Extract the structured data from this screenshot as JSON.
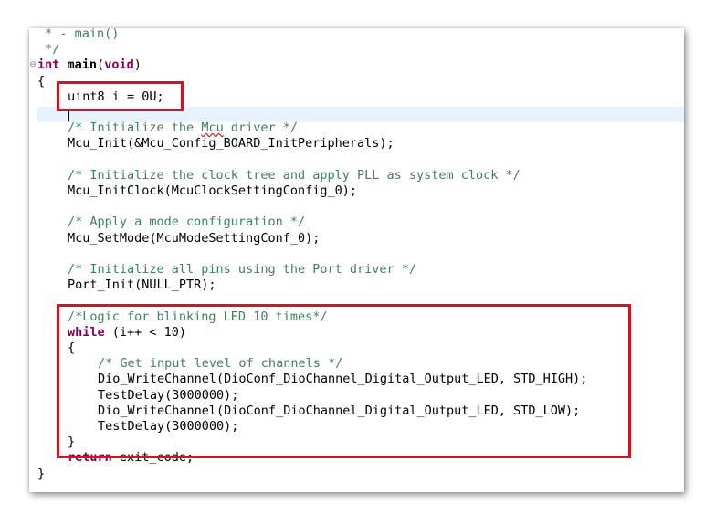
{
  "editor": {
    "lines": [
      {
        "indent": 0,
        "parts": [
          {
            "c": "cm",
            "t": " * - main()"
          }
        ]
      },
      {
        "indent": 0,
        "parts": [
          {
            "c": "cm",
            "t": " */"
          }
        ]
      },
      {
        "indent": 0,
        "fold": true,
        "parts": [
          {
            "c": "kw",
            "t": "int"
          },
          {
            "c": "",
            "t": " "
          },
          {
            "c": "b",
            "t": "main"
          },
          {
            "c": "",
            "t": "("
          },
          {
            "c": "kw",
            "t": "void"
          },
          {
            "c": "",
            "t": ")"
          }
        ]
      },
      {
        "indent": 0,
        "parts": [
          {
            "c": "",
            "t": "{"
          }
        ]
      },
      {
        "indent": 1,
        "parts": [
          {
            "c": "",
            "t": "uint8 i = 0U;"
          }
        ]
      },
      {
        "indent": 1,
        "parts": [
          {
            "c": "",
            "t": ""
          }
        ]
      },
      {
        "indent": 1,
        "parts": [
          {
            "c": "cm",
            "t": "/* Initialize the "
          },
          {
            "c": "cm ul",
            "t": "Mcu"
          },
          {
            "c": "cm",
            "t": " driver */"
          }
        ]
      },
      {
        "indent": 1,
        "parts": [
          {
            "c": "",
            "t": "Mcu_Init(&Mcu_Config_BOARD_InitPeripherals);"
          }
        ]
      },
      {
        "indent": 1,
        "parts": [
          {
            "c": "",
            "t": ""
          }
        ]
      },
      {
        "indent": 1,
        "parts": [
          {
            "c": "cm",
            "t": "/* Initialize the clock tree and apply PLL as system clock */"
          }
        ]
      },
      {
        "indent": 1,
        "parts": [
          {
            "c": "",
            "t": "Mcu_InitClock(McuClockSettingConfig_0);"
          }
        ]
      },
      {
        "indent": 1,
        "parts": [
          {
            "c": "",
            "t": ""
          }
        ]
      },
      {
        "indent": 1,
        "parts": [
          {
            "c": "cm",
            "t": "/* Apply a mode configuration */"
          }
        ]
      },
      {
        "indent": 1,
        "parts": [
          {
            "c": "",
            "t": "Mcu_SetMode(McuModeSettingConf_0);"
          }
        ]
      },
      {
        "indent": 1,
        "parts": [
          {
            "c": "",
            "t": ""
          }
        ]
      },
      {
        "indent": 1,
        "parts": [
          {
            "c": "cm",
            "t": "/* Initialize all pins using the Port driver */"
          }
        ]
      },
      {
        "indent": 1,
        "parts": [
          {
            "c": "",
            "t": "Port_Init(NULL_PTR);"
          }
        ]
      },
      {
        "indent": 1,
        "parts": [
          {
            "c": "",
            "t": ""
          }
        ]
      },
      {
        "indent": 1,
        "parts": [
          {
            "c": "cm",
            "t": "/*Logic for blinking LED 10 times*/"
          }
        ]
      },
      {
        "indent": 1,
        "parts": [
          {
            "c": "kw",
            "t": "while"
          },
          {
            "c": "",
            "t": " (i++ < 10)"
          }
        ]
      },
      {
        "indent": 1,
        "parts": [
          {
            "c": "",
            "t": "{"
          }
        ]
      },
      {
        "indent": 2,
        "parts": [
          {
            "c": "cm",
            "t": "/* Get input level of channels */"
          }
        ]
      },
      {
        "indent": 2,
        "parts": [
          {
            "c": "",
            "t": "Dio_WriteChannel(DioConf_DioChannel_Digital_Output_LED, STD_HIGH);"
          }
        ]
      },
      {
        "indent": 2,
        "parts": [
          {
            "c": "",
            "t": "TestDelay(3000000);"
          }
        ]
      },
      {
        "indent": 2,
        "parts": [
          {
            "c": "",
            "t": "Dio_WriteChannel(DioConf_DioChannel_Digital_Output_LED, STD_LOW);"
          }
        ]
      },
      {
        "indent": 2,
        "parts": [
          {
            "c": "",
            "t": "TestDelay(3000000);"
          }
        ]
      },
      {
        "indent": 1,
        "parts": [
          {
            "c": "",
            "t": "}"
          }
        ]
      },
      {
        "indent": 1,
        "parts": [
          {
            "c": "kw",
            "t": "return"
          },
          {
            "c": "",
            "t": " exit_code;"
          }
        ]
      },
      {
        "indent": 0,
        "parts": [
          {
            "c": "",
            "t": "}"
          }
        ]
      }
    ]
  },
  "annotations": {
    "highlight_color": "#d6121f"
  }
}
